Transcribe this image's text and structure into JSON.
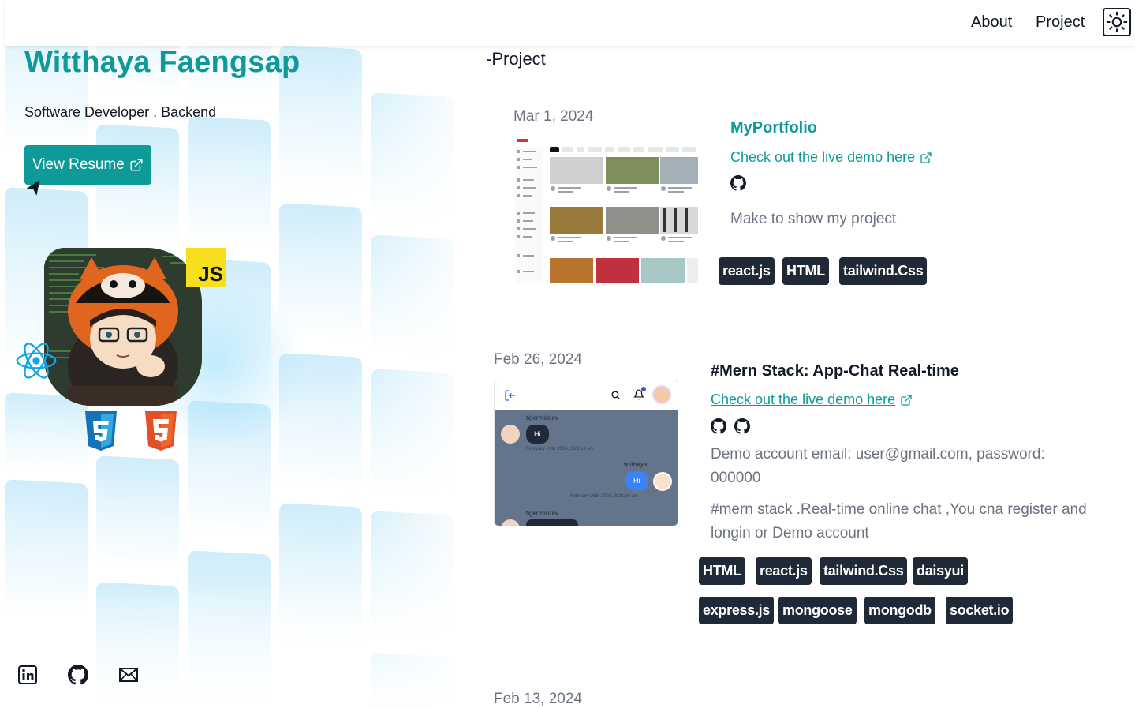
{
  "nav": {
    "about": "About",
    "project": "Project",
    "theme_icon": "sun-icon"
  },
  "profile": {
    "name": "Witthaya Faengsap",
    "role": "Software Developer . Backend",
    "resume_label": "View Resume",
    "tech_badges": [
      "JS",
      "react",
      "css3",
      "html5"
    ],
    "socials": [
      "linkedin-icon",
      "github-icon",
      "mail-icon"
    ]
  },
  "colors": {
    "accent": "#0e9a9a",
    "tag_bg": "#1f2937",
    "muted_text": "#6b7280"
  },
  "projects_section": {
    "title": "-Project"
  },
  "projects": [
    {
      "date": "Mar 1, 2024",
      "title": "MyPortfolio",
      "demo_label": "Check out the live demo here",
      "description": "Make to show my project",
      "tags": [
        "react.js",
        "HTML",
        "tailwind.Css"
      ]
    },
    {
      "date": "Feb 26, 2024",
      "title": "#Mern Stack: App-Chat Real-time",
      "demo_label": "Check out the live demo here",
      "description_1": "Demo account email: user@gmail.com, password: 000000",
      "description_2": "#mern stack .Real-time online chat ,You cna register and longin or Demo account",
      "tags": [
        "HTML",
        "react.js",
        "tailwind.Css",
        "daisyui",
        "express.js",
        "mongoose",
        "mongodb",
        "socket.io"
      ],
      "chat_preview": {
        "user1": "tigermixdev",
        "msg1": "Hi",
        "time1": "February 26th 2024, 3:28:50 am",
        "user2": "witthaya",
        "msg2": "Hi",
        "time2": "February 26th 2024, 3:28:59 am",
        "user3": "tigermixdev"
      }
    },
    {
      "date": "Feb 13, 2024"
    }
  ]
}
